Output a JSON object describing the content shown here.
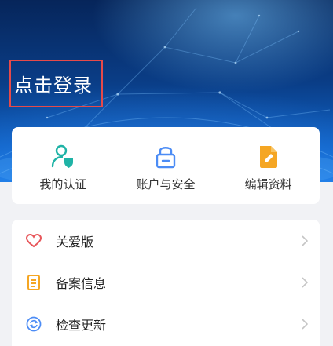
{
  "header": {
    "login_label": "点击登录"
  },
  "quick_actions": [
    {
      "label": "我的认证",
      "icon": "user-verified-icon"
    },
    {
      "label": "账户与安全",
      "icon": "lock-icon"
    },
    {
      "label": "编辑资料",
      "icon": "edit-document-icon"
    }
  ],
  "menu": [
    {
      "label": "关爱版",
      "icon": "heart-icon"
    },
    {
      "label": "备案信息",
      "icon": "record-document-icon"
    },
    {
      "label": "检查更新",
      "icon": "refresh-icon"
    }
  ],
  "colors": {
    "accent_teal": "#1fb3a6",
    "accent_blue": "#4c8cf5",
    "accent_orange": "#f5a623",
    "heart_red": "#e8575b",
    "highlight_border": "#e64a4a",
    "hero_dark": "#06255a",
    "hero_light": "#1877e0"
  }
}
